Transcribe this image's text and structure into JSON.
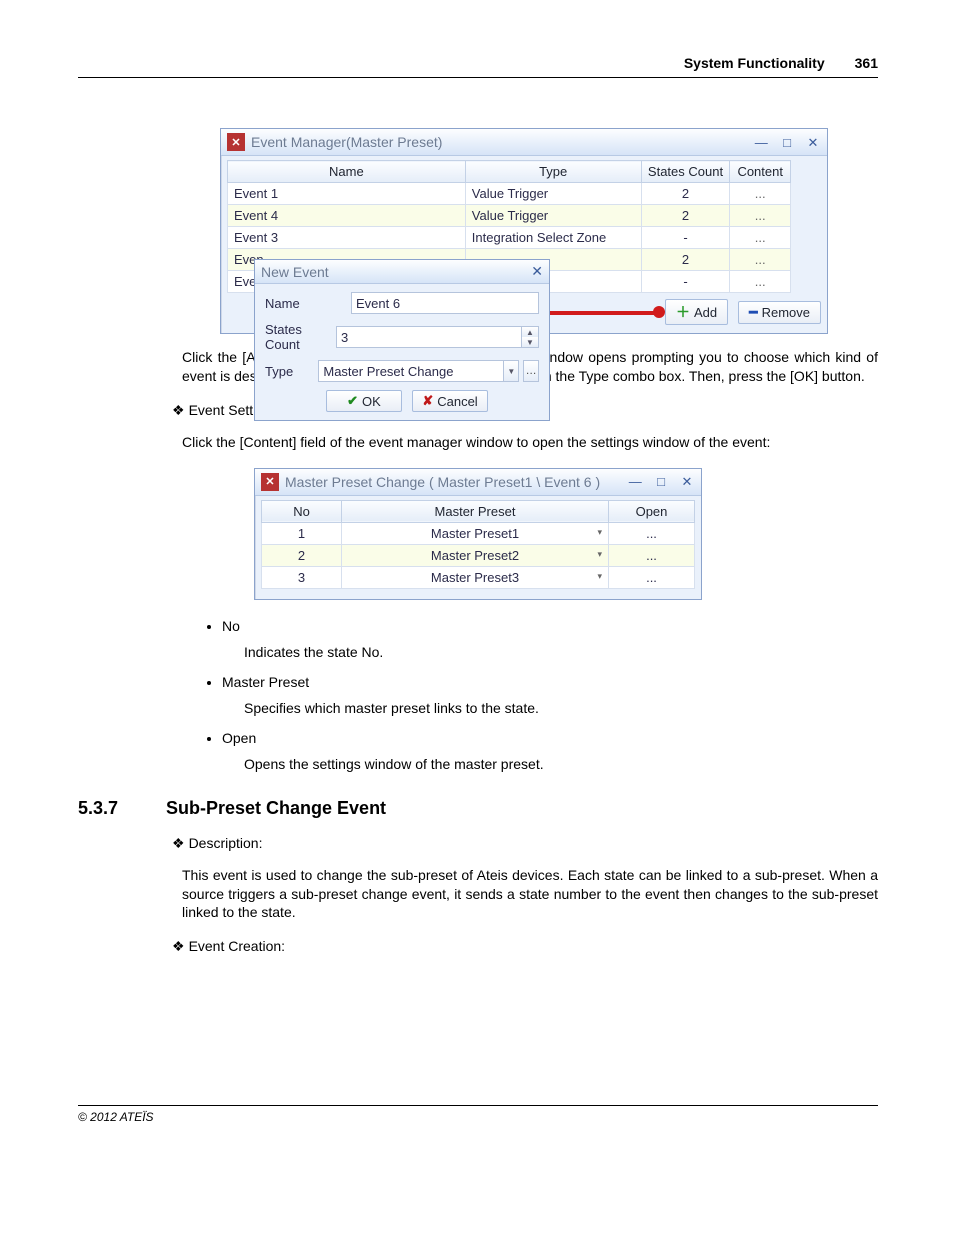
{
  "header": {
    "title": "System Functionality",
    "page": "361"
  },
  "event_manager": {
    "title": "Event Manager(Master Preset)",
    "columns": [
      "Name",
      "Type",
      "States Count",
      "Content"
    ],
    "rows": [
      {
        "name": "Event 1",
        "type": "Value Trigger",
        "count": "2",
        "content": "..."
      },
      {
        "name": "Event 4",
        "type": "Value Trigger",
        "count": "2",
        "content": "..."
      },
      {
        "name": "Event 3",
        "type": "Integration Select Zone",
        "count": "-",
        "content": "..."
      },
      {
        "name": "Even",
        "type": "",
        "count": "2",
        "content": "..."
      },
      {
        "name": "Even",
        "type": "",
        "count": "-",
        "content": "..."
      }
    ],
    "add": "Add",
    "remove": "Remove"
  },
  "new_event": {
    "title": "New Event",
    "labels": {
      "name": "Name",
      "states": "States Count",
      "type": "Type"
    },
    "values": {
      "name": "Event 6",
      "states": "3",
      "type": "Master Preset Change"
    },
    "ok": "OK",
    "cancel": "Cancel"
  },
  "doc": {
    "p1": "Click the [Add] button to create a new event, a second window opens prompting you to choose which kind of event is desired. Select the item [Master Preset Change] on the Type combo box. Then, press the [OK] button.",
    "event_settings": "Event Settings",
    "p2": "Click the [Content] field of the event manager window to open the settings window of the event:"
  },
  "mp_window": {
    "title": "Master Preset Change ( Master Preset1 \\ Event 6 )",
    "columns": [
      "No",
      "Master Preset",
      "Open"
    ],
    "rows": [
      {
        "no": "1",
        "preset": "Master Preset1",
        "open": "..."
      },
      {
        "no": "2",
        "preset": "Master Preset2",
        "open": "..."
      },
      {
        "no": "3",
        "preset": "Master Preset3",
        "open": "..."
      }
    ]
  },
  "bullets": {
    "no": {
      "h": "No",
      "t": "Indicates the state No."
    },
    "mp": {
      "h": "Master Preset",
      "t": "Specifies which master preset links to the state."
    },
    "open": {
      "h": "Open",
      "t": "Opens the settings window of the master preset."
    }
  },
  "section": {
    "num": "5.3.7",
    "title": "Sub-Preset Change Event"
  },
  "subsec": {
    "desc": "Description:",
    "p3": "This event is used to change the sub-preset of Ateis devices. Each state can be linked to a sub-preset. When a source triggers a sub-preset change event, it sends a state number to the event then changes to the sub-preset linked to the state.",
    "creation": "Event Creation:"
  },
  "footer": "© 2012 ATEÏS"
}
